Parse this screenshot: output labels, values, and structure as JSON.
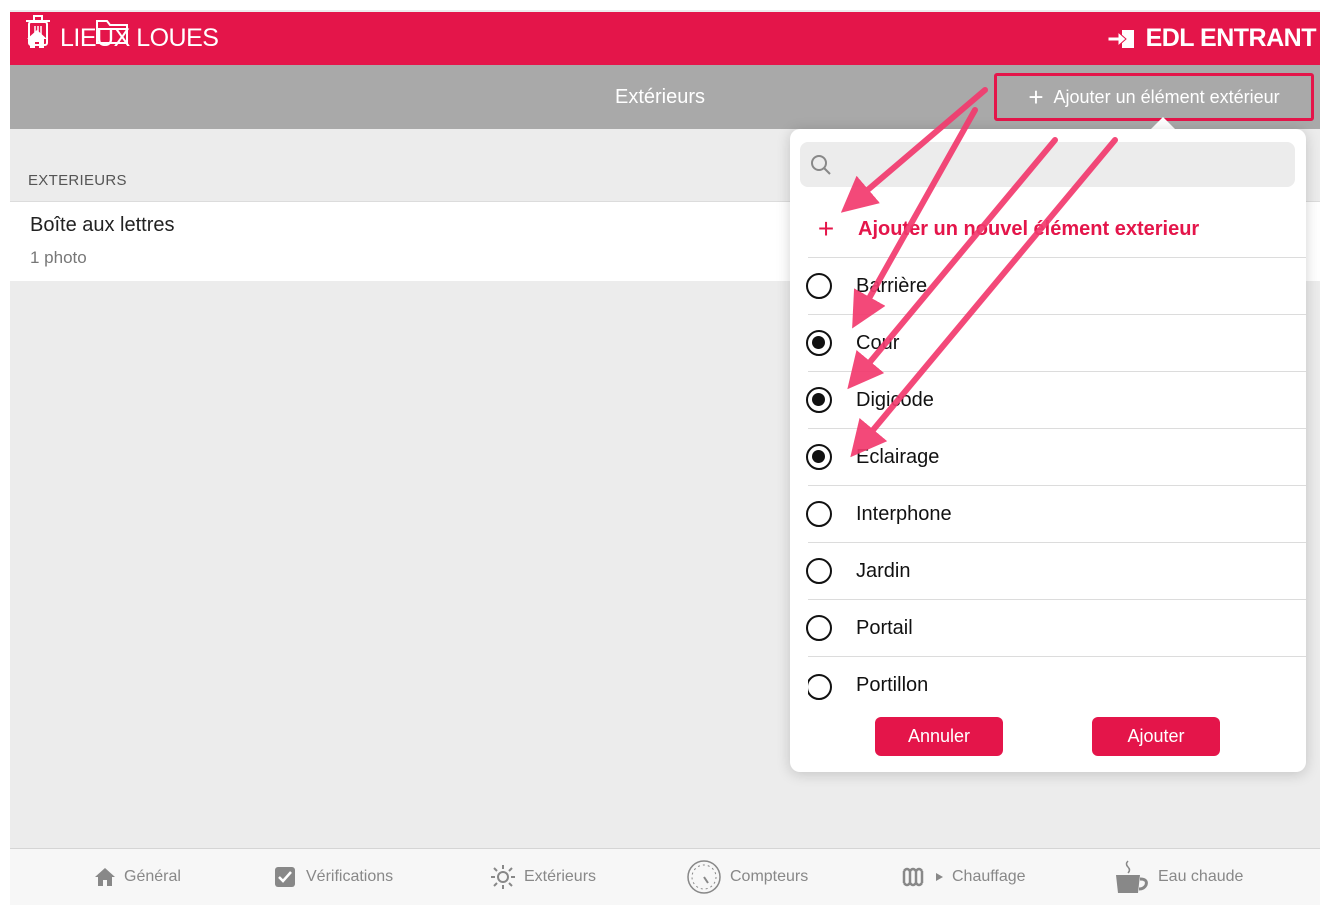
{
  "header": {
    "title": "LIEUX LOUES",
    "mode_label": "EDL ENTRANT"
  },
  "toolbar": {
    "title": "Extérieurs",
    "add_button_label": "Ajouter un élément extérieur"
  },
  "list": {
    "section_header": "EXTERIEURS",
    "rows": [
      {
        "title": "Boîte aux lettres",
        "subtitle": "1 photo"
      }
    ]
  },
  "popover": {
    "search_placeholder": "",
    "add_new_label": "Ajouter un nouvel élément exterieur",
    "options": [
      {
        "label": "Barrière",
        "selected": false
      },
      {
        "label": "Cour",
        "selected": true
      },
      {
        "label": "Digicode",
        "selected": true
      },
      {
        "label": "Eclairage",
        "selected": true
      },
      {
        "label": "Interphone",
        "selected": false
      },
      {
        "label": "Jardin",
        "selected": false
      },
      {
        "label": "Portail",
        "selected": false
      },
      {
        "label": "Portillon",
        "selected": false
      }
    ],
    "cancel_label": "Annuler",
    "submit_label": "Ajouter"
  },
  "tabbar": {
    "tabs": [
      {
        "label": "Général",
        "icon": "house-icon"
      },
      {
        "label": "Vérifications",
        "icon": "checkbox-icon"
      },
      {
        "label": "Extérieurs",
        "icon": "sun-icon"
      },
      {
        "label": "Compteurs",
        "icon": "gauge-icon"
      },
      {
        "label": "Chauffage",
        "icon": "radiator-icon"
      },
      {
        "label": "Eau chaude",
        "icon": "cup-icon"
      }
    ]
  },
  "colors": {
    "accent": "#e4154a",
    "toolbar": "#a9a9a9",
    "background": "#ececec"
  }
}
